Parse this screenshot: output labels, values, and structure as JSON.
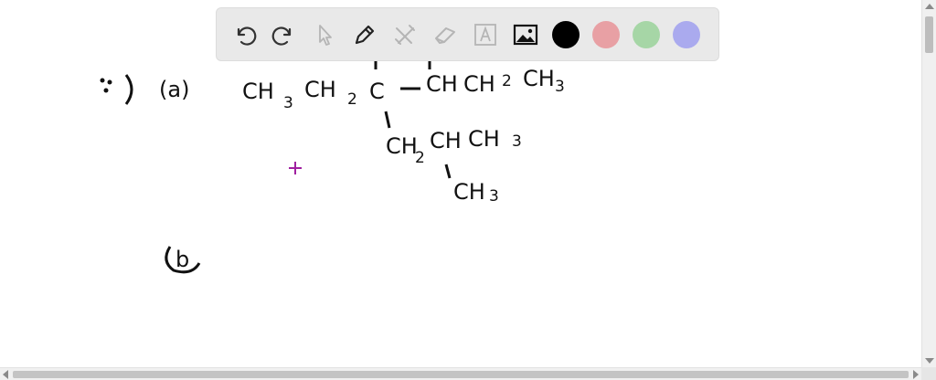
{
  "toolbar": {
    "tools": [
      "undo-icon",
      "redo-icon",
      "select-pointer-icon",
      "pen-icon",
      "tools-icon",
      "eraser-icon",
      "text-box-icon",
      "image-icon"
    ],
    "colors": [
      "#000000",
      "#e8a0a4",
      "#a6d6a6",
      "#aaaaee"
    ]
  },
  "drawing": {
    "bullet": "∵)",
    "part_a_label": "(a)",
    "main_chain": {
      "ch3": "CH",
      "ch3_sub": "3",
      "ch2": "CH",
      "ch2_sub": "2",
      "c": "C",
      "dash": "—",
      "ch": "CH",
      "ch2b": "CH",
      "ch2b_sub": "2",
      "ch3b": "CH",
      "ch3b_sub": "3"
    },
    "branch_1": {
      "ch2": "CH",
      "ch2_sub": "2",
      "ch": "CH",
      "ch3": "CH",
      "ch3_sub": "3"
    },
    "branch_2": {
      "ch3": "CH",
      "ch3_sub": "3"
    },
    "part_b_label": "b"
  },
  "cursor_color": "#a020a0"
}
